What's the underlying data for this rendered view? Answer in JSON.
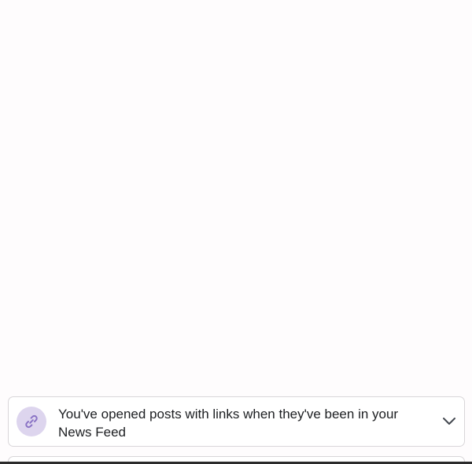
{
  "activity_item": {
    "icon": "link-icon",
    "text": "You've opened posts with links when they've been in your News Feed",
    "expand_icon": "chevron-down-icon",
    "icon_bg_color": "#ddd5ee",
    "icon_color": "#8a73c5"
  }
}
